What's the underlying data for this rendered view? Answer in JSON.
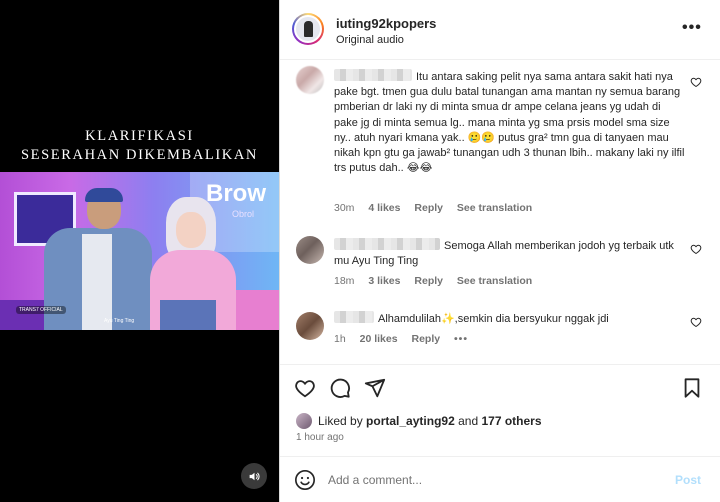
{
  "video": {
    "caption_line1": "KLARIFIKASI",
    "caption_line2": "SESERAHAN DIKEMBALIKAN",
    "logo_text": "Brow",
    "logo_sub": "Obrol",
    "channel_badge": "TRANS7 OFFICIAL",
    "subtitle": "Ayu Ting Ting",
    "audio_icon": "speaker-icon"
  },
  "post": {
    "username": "iuting92kpopers",
    "audio_label": "Original audio",
    "more_label": "•••"
  },
  "comments": [
    {
      "text": "Itu antara saking pelit nya sama antara sakit hati nya pake bgt. tmen gua dulu batal tunangan ama mantan ny semua barang pmberian dr laki ny di minta smua dr ampe celana jeans yg udah di pake jg di minta semua lg.. mana minta yg sma prsis model sma size ny.. atuh nyari kmana yak.. 🥲🥲 putus gra² tmn gua di tanyaen mau nikah kpn gtu ga jawab² tunangan udh 3 thunan lbih.. makany laki ny ilfil trs putus dah.. 😂😂",
      "time": "30m",
      "likes": "4 likes",
      "reply": "Reply",
      "translate": "See translation"
    },
    {
      "text": "Semoga Allah memberikan jodoh yg terbaik utk mu Ayu Ting Ting",
      "time": "18m",
      "likes": "3 likes",
      "reply": "Reply",
      "translate": "See translation"
    },
    {
      "text": "Alhamdulilah✨,semkin dia bersyukur nggak jdi",
      "time": "1h",
      "likes": "20 likes",
      "reply": "Reply",
      "more": "•••"
    }
  ],
  "likes": {
    "prefix": "Liked by",
    "user": "portal_ayting92",
    "joiner": "and",
    "others": "177 others"
  },
  "time_ago": "1 hour ago",
  "add_comment": {
    "placeholder": "Add a comment...",
    "post_label": "Post"
  },
  "colors": {
    "text": "#262626",
    "secondary": "#737373",
    "post_button_disabled": "#b2dffc",
    "divider": "#efefef"
  }
}
